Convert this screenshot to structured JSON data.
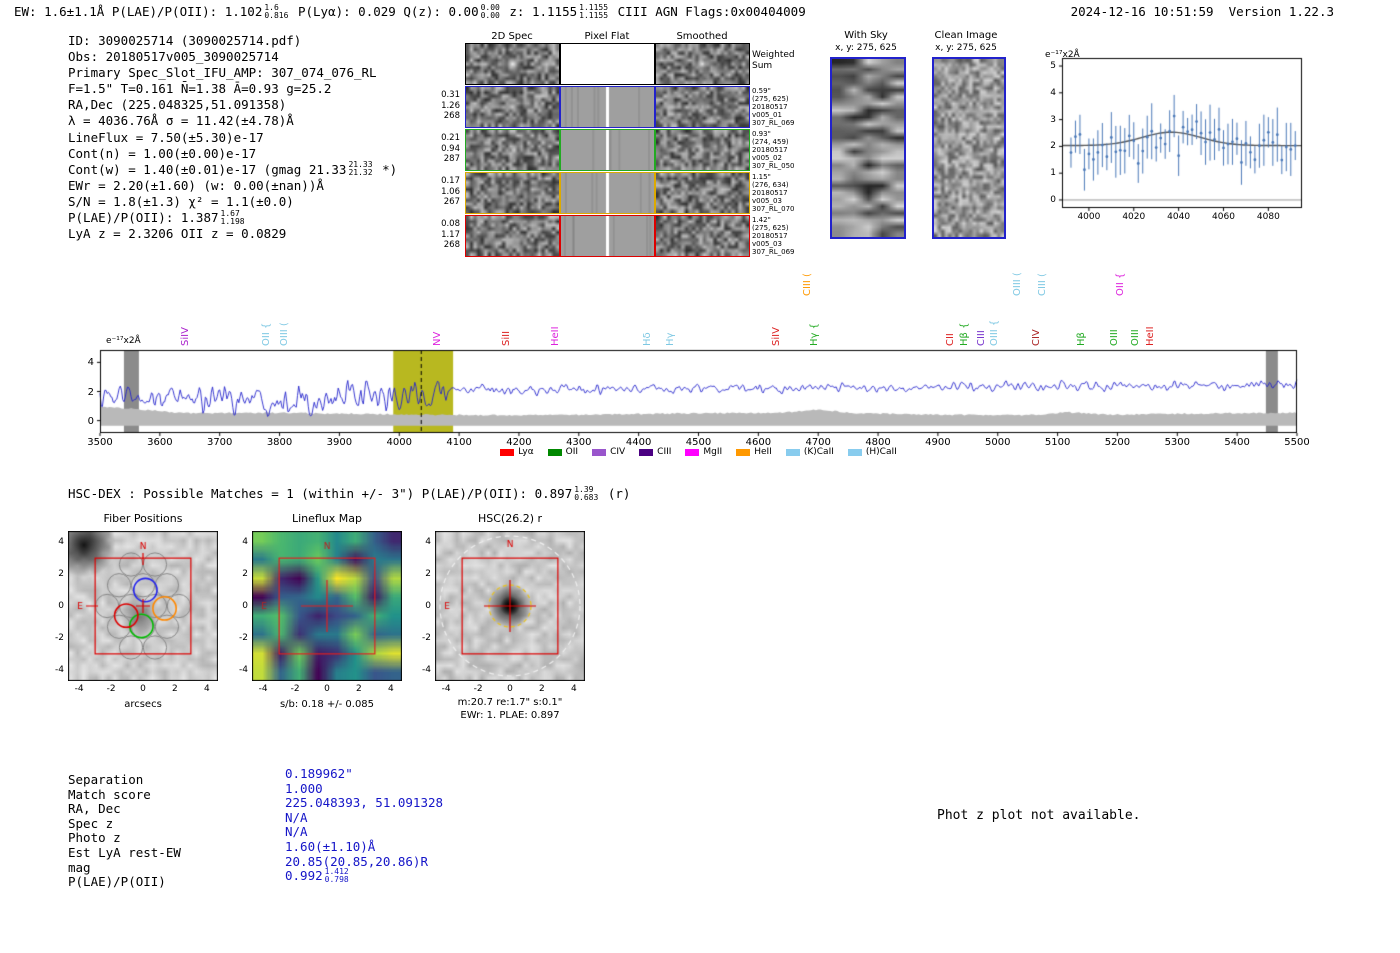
{
  "header": {
    "segments": [
      {
        "t": "EW: 1.6±1.1Å  "
      },
      {
        "t": "P(LAE)/P(OII): 1.102"
      },
      {
        "sup": "1.6",
        "sub": "0.816"
      },
      {
        "t": "  P(Lyα): 0.029  Q(z): 0.00"
      },
      {
        "sup": "0.00",
        "sub": "0.00"
      },
      {
        "t": "  z: 1.1155"
      },
      {
        "sup": "1.1155",
        "sub": "1.1155"
      },
      {
        "t": "  CIII  AGN  Flags:0x00404009"
      }
    ],
    "timestamp": "2024-12-16 10:51:59",
    "version": "Version 1.22.3"
  },
  "info_block": {
    "lines": [
      [
        {
          "t": "ID: 3090025714 (3090025714.pdf)"
        }
      ],
      [
        {
          "t": "Obs: 20180517v005_3090025714"
        }
      ],
      [
        {
          "t": "Primary Spec_Slot_IFU_AMP: 307_074_076_RL"
        }
      ],
      [
        {
          "t": "F=1.5\"  T=0.161  N̄=1.38  Ā=0.93  g=25.2"
        }
      ],
      [
        {
          "t": "RA,Dec (225.048325,51.091358)"
        }
      ],
      [
        {
          "t": "λ = 4036.76Å  σ = 11.42(±4.78)Å"
        }
      ],
      [
        {
          "t": "LineFlux = 7.50(±5.30)e-17"
        }
      ],
      [
        {
          "t": "Cont(n) = 1.00(±0.00)e-17"
        }
      ],
      [
        {
          "t": "Cont(w) = 1.40(±0.01)e-17 (gmag 21.33"
        },
        {
          "sup": "21.33",
          "sub": "21.32"
        },
        {
          "t": " *)"
        }
      ],
      [
        {
          "t": "EWr = 2.20(±1.60) (w: 0.00(±nan))Å"
        }
      ],
      [
        {
          "t": "S/N = 1.8(±1.3)  χ² = 1.1(±0.0)"
        }
      ],
      [
        {
          "t": "P(LAE)/P(OII): 1.387"
        },
        {
          "sup": "1.67",
          "sub": "1.198"
        }
      ],
      [
        {
          "t": "LyA z = 2.3206  OII z = 0.0829"
        }
      ]
    ]
  },
  "spec2d": {
    "col_titles": [
      "2D Spec",
      "Pixel Flat",
      "Smoothed"
    ],
    "rows": [
      {
        "border": "#000000",
        "left": [],
        "right": [
          "Weighted",
          "Sum"
        ]
      },
      {
        "border": "#2222cc",
        "left": [
          "0.31",
          "1.26",
          "268"
        ],
        "right": [
          "0.59\"",
          "(275, 625)",
          "20180517",
          "v005_01",
          "307_RL_069"
        ]
      },
      {
        "border": "#22aa22",
        "left": [
          "0.21",
          "0.94",
          "287"
        ],
        "right": [
          "0.93\"",
          "(274, 459)",
          "20180517",
          "v005_02",
          "307_RL_050"
        ]
      },
      {
        "border": "#ddaa00",
        "left": [
          "0.17",
          "1.06",
          "267"
        ],
        "right": [
          "1.15\"",
          "(276, 634)",
          "20180517",
          "v005_03",
          "307_RL_070"
        ]
      },
      {
        "border": "#dd0000",
        "left": [
          "0.08",
          "1.17",
          "268"
        ],
        "right": [
          "1.42\"",
          "(275, 625)",
          "20180517",
          "v005_03",
          "307_RL_069"
        ]
      }
    ]
  },
  "withsky": {
    "title": "With Sky",
    "subtitle": "x, y: 275, 625"
  },
  "clean": {
    "title": "Clean Image",
    "subtitle": "x, y: 275, 625"
  },
  "hsc_header": {
    "segments": [
      {
        "t": "HSC-DEX : Possible Matches = 1 (within +/- 3\")  P(LAE)/P(OII): 0.897"
      },
      {
        "sup": "1.39",
        "sub": "0.683"
      },
      {
        "t": " (r)"
      }
    ]
  },
  "cutouts": {
    "fiber": {
      "title": "Fiber Positions",
      "xlabel": "arcsecs",
      "ticks": [
        -4,
        -2,
        0,
        2,
        4
      ],
      "compass_n": "N",
      "compass_e": "E"
    },
    "lineflux": {
      "title": "Lineflux Map",
      "caption": "s/b: 0.18 +/- 0.085",
      "ticks": [
        -4,
        -2,
        0,
        2,
        4
      ],
      "compass_n": "N",
      "compass_e": "E"
    },
    "hsc": {
      "title": "HSC(26.2) r",
      "caption1": "m:20.7 re:1.7\" s:0.1\"",
      "caption2": "EWr: 1. PLAE: 0.897",
      "ticks": [
        -4,
        -2,
        0,
        2,
        4
      ],
      "compass_n": "N",
      "compass_e": "E"
    }
  },
  "match_table": {
    "rows": [
      {
        "label": "Separation",
        "value": "0.189962\""
      },
      {
        "label": "Match score",
        "value": "1.000"
      },
      {
        "label": "RA, Dec",
        "value": "225.048393, 51.091328"
      },
      {
        "label": "Spec z",
        "value": "N/A"
      },
      {
        "label": "Photo z",
        "value": "N/A"
      },
      {
        "label": "Est LyA rest-EW",
        "value": "1.60(±1.10)Å"
      },
      {
        "label": "mag",
        "value": "20.85(20.85,20.86)R"
      },
      {
        "label": "P(LAE)/P(OII)",
        "value": "0.992",
        "sup": "1.412",
        "sub": "0.798"
      }
    ]
  },
  "photz_note": "Phot z plot not available.",
  "chart_data": [
    {
      "id": "line_fit",
      "type": "scatter",
      "ylabel": "e⁻¹⁷x2Å",
      "xlim": [
        3988,
        4095
      ],
      "ylim": [
        -0.3,
        5.3
      ],
      "xticks": [
        4000,
        4020,
        4040,
        4060,
        4080
      ],
      "yticks": [
        0,
        1,
        2,
        3,
        4,
        5
      ],
      "fit_curve": {
        "shape": "gaussian",
        "mu": 4036.76,
        "sigma": 11.42,
        "amplitude": 0.5,
        "continuum": 2.03
      },
      "point_color": "#4b79b8",
      "curve_color": "#555555",
      "description": "flux errorbar points vs wavelength around detected line 4036.76Å"
    },
    {
      "id": "full_spectrum",
      "type": "line",
      "ylabel": "e⁻¹⁷x2Å",
      "xlim": [
        3500,
        5500
      ],
      "ylim": [
        -0.85,
        4.85
      ],
      "xticks": [
        3500,
        3600,
        3700,
        3800,
        3900,
        4000,
        4100,
        4200,
        4300,
        4400,
        4500,
        4600,
        4700,
        4800,
        4900,
        5000,
        5100,
        5200,
        5300,
        5400,
        5500
      ],
      "yticks": [
        0,
        2,
        4
      ],
      "line_color": "#2222cc",
      "detected_line_wavelength": 4036.76,
      "highlight_region": [
        3990,
        4090
      ],
      "masked_bands": [
        [
          3540,
          3565
        ],
        [
          5448,
          5468
        ]
      ],
      "continuum_blue": 1.55,
      "continuum_red": 2.1,
      "error_band_level": 0.45,
      "legend": [
        {
          "label": "Lyα",
          "color": "#ff0000"
        },
        {
          "label": "OII",
          "color": "#008800"
        },
        {
          "label": "CIV",
          "color": "#9955cc"
        },
        {
          "label": "CIII",
          "color": "#4b0082"
        },
        {
          "label": "MgII",
          "color": "#ff00ff"
        },
        {
          "label": "HeII",
          "color": "#ff9900"
        },
        {
          "label": "(K)CaII",
          "color": "#88ccee"
        },
        {
          "label": "(H)CaII",
          "color": "#88ccee"
        }
      ],
      "line_markers": [
        {
          "label": "SiIV",
          "wl": 3660,
          "color": "#aa22cc",
          "level": 1
        },
        {
          "label": "OII {",
          "wl": 3795,
          "color": "#7ec8e3",
          "level": 1
        },
        {
          "label": "OIII (",
          "wl": 3826,
          "color": "#7ec8e3",
          "level": 1
        },
        {
          "label": "NV",
          "wl": 4082,
          "color": "#dd22dd",
          "level": 1
        },
        {
          "label": "SiII",
          "wl": 4196,
          "color": "#dd2222",
          "level": 1
        },
        {
          "label": "HeII",
          "wl": 4278,
          "color": "#dd22dd",
          "level": 1
        },
        {
          "label": "Hδ",
          "wl": 4432,
          "color": "#7ec8e3",
          "level": 1
        },
        {
          "label": "Hγ",
          "wl": 4470,
          "color": "#7ec8e3",
          "level": 1
        },
        {
          "label": "SiIV",
          "wl": 4648,
          "color": "#dd2222",
          "level": 1
        },
        {
          "label": "CIII (",
          "wl": 4700,
          "color": "#ff9900",
          "level": 2
        },
        {
          "label": "Hγ {",
          "wl": 4712,
          "color": "#22aa22",
          "level": 1
        },
        {
          "label": "CII",
          "wl": 4938,
          "color": "#dd2222",
          "level": 1
        },
        {
          "label": "Hβ {",
          "wl": 4962,
          "color": "#22aa22",
          "level": 1
        },
        {
          "label": "CIII",
          "wl": 4990,
          "color": "#7733cc",
          "level": 1
        },
        {
          "label": "OIII {",
          "wl": 5012,
          "color": "#7ec8e3",
          "level": 1
        },
        {
          "label": "OIII (",
          "wl": 5050,
          "color": "#7ec8e3",
          "level": 2
        },
        {
          "label": "CIII (",
          "wl": 5092,
          "color": "#7ec8e3",
          "level": 2
        },
        {
          "label": "CIV",
          "wl": 5082,
          "color": "#aa2222",
          "level": 1
        },
        {
          "label": "Hβ",
          "wl": 5158,
          "color": "#22aa22",
          "level": 1
        },
        {
          "label": "OIII",
          "wl": 5212,
          "color": "#22aa22",
          "level": 1
        },
        {
          "label": "OII {",
          "wl": 5222,
          "color": "#dd22dd",
          "level": 2
        },
        {
          "label": "OIII",
          "wl": 5248,
          "color": "#22aa22",
          "level": 1
        },
        {
          "label": "HeII",
          "wl": 5272,
          "color": "#dd2222",
          "level": 1
        }
      ]
    }
  ]
}
